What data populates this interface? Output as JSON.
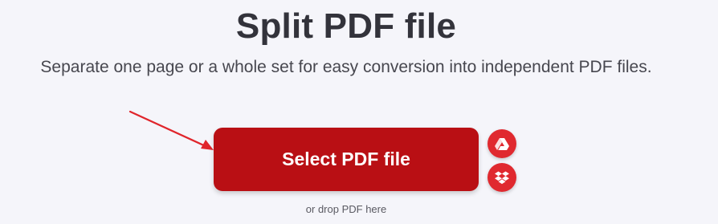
{
  "header": {
    "title": "Split PDF file",
    "subtitle": "Separate one page or a whole set for easy conversion into independent PDF files."
  },
  "upload": {
    "select_label": "Select PDF file",
    "drop_hint": "or drop PDF here",
    "google_drive_icon": "google-drive-icon",
    "dropbox_icon": "dropbox-icon"
  },
  "colors": {
    "primary_button": "#b90f14",
    "cloud_button": "#e0292f",
    "annotation_arrow": "#e0252b",
    "background": "#f5f5fa"
  }
}
